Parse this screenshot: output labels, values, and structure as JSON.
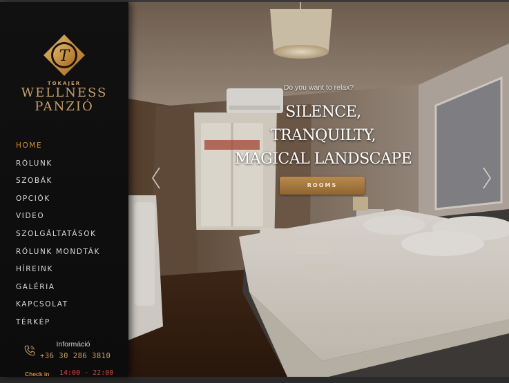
{
  "brand": {
    "small": "TOKAJER",
    "line1": "WELLNESS",
    "line2": "PANZIÓ",
    "logo_icon": "tokajer-logo-icon"
  },
  "nav": {
    "items": [
      {
        "label": "HOME",
        "active": true
      },
      {
        "label": "RÓLUNK"
      },
      {
        "label": "SZOBÁK"
      },
      {
        "label": "OPCIÓK"
      },
      {
        "label": "VIDEO"
      },
      {
        "label": "SZOLGÁLTATÁSOK"
      },
      {
        "label": "RÓLUNK MONDTÁK"
      },
      {
        "label": "HÍREINK"
      },
      {
        "label": "GALÉRIA"
      },
      {
        "label": "KAPCSOLAT"
      },
      {
        "label": "TÉRKÉP"
      }
    ]
  },
  "info": {
    "title": "Információ",
    "phone": "+36 30 286 3810",
    "icon": "phone-icon"
  },
  "checkin": {
    "label": "Check in",
    "time": "14:00 - 22:00"
  },
  "hero": {
    "subtitle": "Do you want to relax?",
    "title_lines": [
      "SILENCE,",
      "TRANQUILTY,",
      "MAGICAL LANDSCAPE"
    ],
    "button_label": "ROOMS",
    "prev_icon": "chevron-left-icon",
    "next_icon": "chevron-right-icon"
  },
  "colors": {
    "accent": "#d4892e",
    "gold": "#c9a06a",
    "sidebar_bg": "#0e0e0e",
    "button": "#a87a40"
  }
}
